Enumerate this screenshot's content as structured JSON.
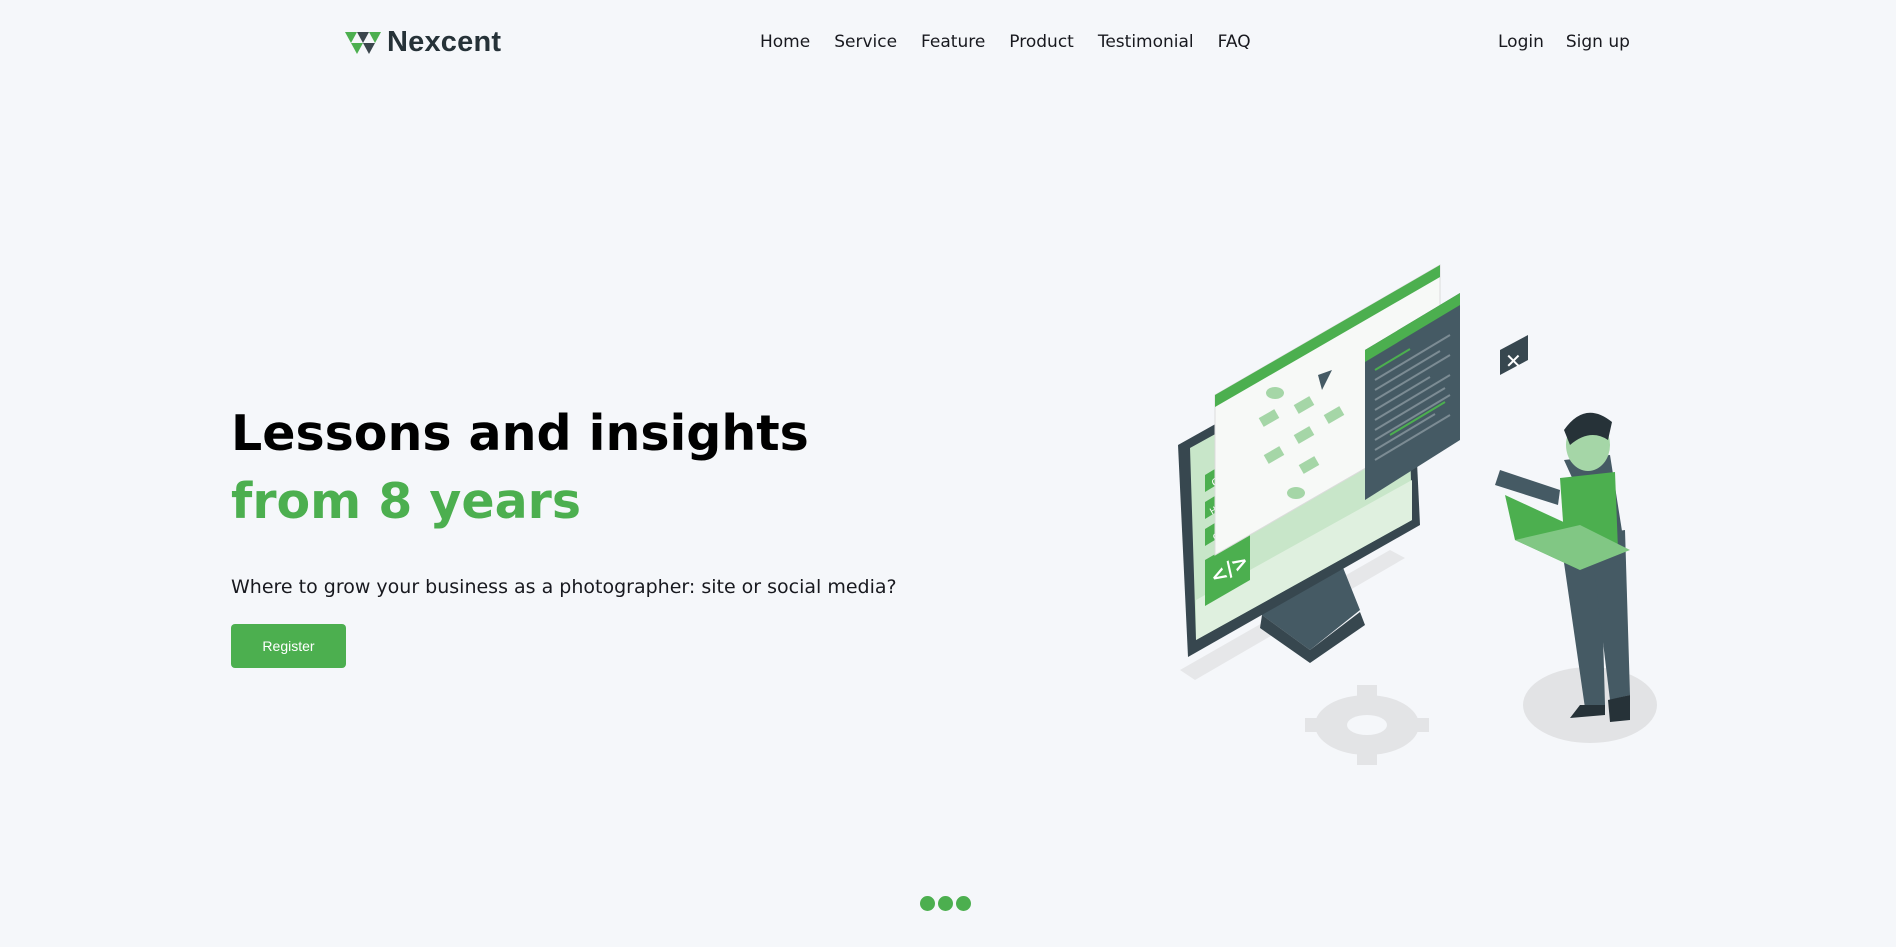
{
  "brand": {
    "name": "Nexcent",
    "accent": "#4caf4f",
    "dark": "#263238",
    "icon": "triangles-logo-icon"
  },
  "nav": {
    "items": [
      "Home",
      "Service",
      "Feature",
      "Product",
      "Testimonial",
      "FAQ"
    ]
  },
  "auth": {
    "login": "Login",
    "signup": "Sign up"
  },
  "hero": {
    "title_line1": "Lessons and insights",
    "title_line2": "from 8 years",
    "subtitle": "Where to grow your business as a photographer: site or social media?",
    "button": "Register",
    "illustration": "developer-at-monitor-illustration"
  },
  "carousel": {
    "slides": 3
  }
}
